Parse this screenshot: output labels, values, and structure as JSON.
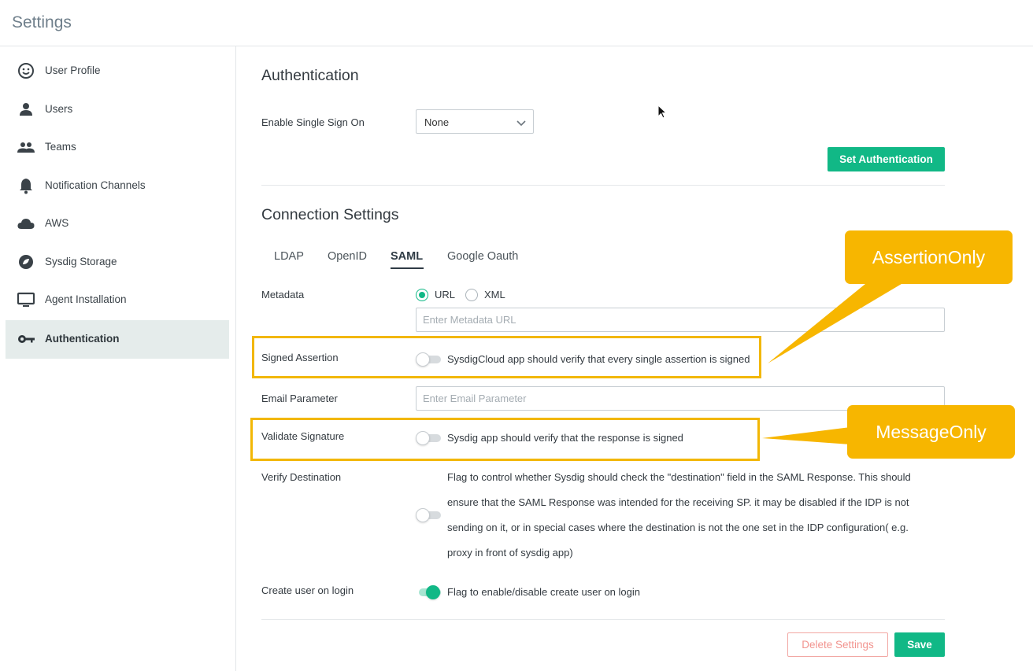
{
  "header": {
    "title": "Settings"
  },
  "sidebar": {
    "items": [
      {
        "label": "User Profile",
        "icon": "smiley-face-icon"
      },
      {
        "label": "Users",
        "icon": "user-icon"
      },
      {
        "label": "Teams",
        "icon": "team-icon"
      },
      {
        "label": "Notification Channels",
        "icon": "bell-icon"
      },
      {
        "label": "AWS",
        "icon": "cloud-icon"
      },
      {
        "label": "Sysdig Storage",
        "icon": "storage-icon"
      },
      {
        "label": "Agent Installation",
        "icon": "monitor-icon"
      },
      {
        "label": "Authentication",
        "icon": "key-icon",
        "active": true
      }
    ]
  },
  "main": {
    "auth_title": "Authentication",
    "sso_label": "Enable Single Sign On",
    "sso_value": "None",
    "set_auth_button": "Set Authentication",
    "connection_title": "Connection Settings",
    "tabs": [
      {
        "label": "LDAP"
      },
      {
        "label": "OpenID"
      },
      {
        "label": "SAML",
        "active": true
      },
      {
        "label": "Google Oauth"
      }
    ],
    "metadata_label": "Metadata",
    "metadata_options": [
      "URL",
      "XML"
    ],
    "metadata_selected": "URL",
    "metadata_placeholder": "Enter Metadata URL",
    "signed_assertion_label": "Signed Assertion",
    "signed_assertion_desc": "SysdigCloud app should verify that every single assertion is signed",
    "signed_assertion_on": false,
    "email_param_label": "Email Parameter",
    "email_param_placeholder": "Enter Email Parameter",
    "validate_sig_label": "Validate Signature",
    "validate_sig_desc": "Sysdig app should verify that the response is signed",
    "validate_sig_on": false,
    "verify_dest_label": "Verify Destination",
    "verify_dest_lines": [
      "Flag to control whether Sysdig should check the \"destination\" field in the SAML Response. This should",
      "ensure that the SAML Response was intended for the receiving SP. it may be disabled if the IDP is not",
      "sending on it, or in special cases where the destination is not the one set in the IDP configuration( e.g.",
      "proxy in front of sysdig app)"
    ],
    "verify_dest_on": false,
    "create_user_label": "Create user on login",
    "create_user_desc": "Flag to enable/disable create user on login",
    "create_user_on": true,
    "delete_button": "Delete Settings",
    "save_button": "Save"
  },
  "annotations": {
    "assertion_callout": "AssertionOnly",
    "message_callout": "MessageOnly"
  },
  "colors": {
    "accent": "#11b886",
    "callout": "#f7b600",
    "danger": "#f2948f"
  }
}
